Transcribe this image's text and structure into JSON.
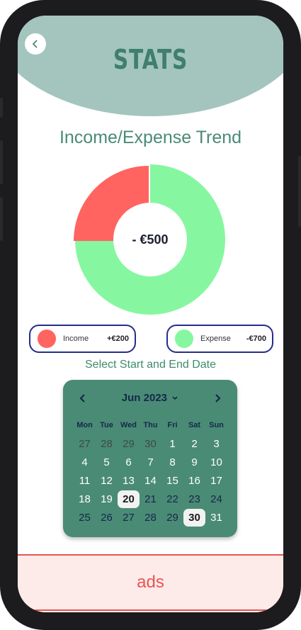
{
  "header": {
    "title": "STATS"
  },
  "section_title": "Income/Expense Trend",
  "donut": {
    "center_label": "- €500",
    "income_fraction": 0.25,
    "expense_fraction": 0.75,
    "income_color": "#ff6461",
    "expense_color": "#86f7a0"
  },
  "legend": {
    "income": {
      "label": "Income",
      "value": "+€200",
      "color": "#ff6461"
    },
    "expense": {
      "label": "Expense",
      "value": "-€700",
      "color": "#86f7a0"
    }
  },
  "date_hint": "Select Start and End Date",
  "calendar": {
    "month_label": "Jun 2023",
    "weekdays": [
      "Mon",
      "Tue",
      "Wed",
      "Thu",
      "Fri",
      "Sat",
      "Sun"
    ],
    "weeks": [
      [
        {
          "d": "27",
          "s": "muted"
        },
        {
          "d": "28",
          "s": "muted"
        },
        {
          "d": "29",
          "s": "muted"
        },
        {
          "d": "30",
          "s": "muted"
        },
        {
          "d": "1",
          "s": ""
        },
        {
          "d": "2",
          "s": ""
        },
        {
          "d": "3",
          "s": ""
        }
      ],
      [
        {
          "d": "4",
          "s": ""
        },
        {
          "d": "5",
          "s": ""
        },
        {
          "d": "6",
          "s": ""
        },
        {
          "d": "7",
          "s": ""
        },
        {
          "d": "8",
          "s": ""
        },
        {
          "d": "9",
          "s": ""
        },
        {
          "d": "10",
          "s": ""
        }
      ],
      [
        {
          "d": "11",
          "s": ""
        },
        {
          "d": "12",
          "s": ""
        },
        {
          "d": "13",
          "s": ""
        },
        {
          "d": "14",
          "s": ""
        },
        {
          "d": "15",
          "s": ""
        },
        {
          "d": "16",
          "s": ""
        },
        {
          "d": "17",
          "s": ""
        }
      ],
      [
        {
          "d": "18",
          "s": ""
        },
        {
          "d": "19",
          "s": ""
        },
        {
          "d": "20",
          "s": "sel"
        },
        {
          "d": "21",
          "s": "dark"
        },
        {
          "d": "22",
          "s": "dark"
        },
        {
          "d": "23",
          "s": "dark"
        },
        {
          "d": "24",
          "s": "dark"
        }
      ],
      [
        {
          "d": "25",
          "s": "dark"
        },
        {
          "d": "26",
          "s": "dark"
        },
        {
          "d": "27",
          "s": "dark"
        },
        {
          "d": "28",
          "s": "dark"
        },
        {
          "d": "29",
          "s": "dark"
        },
        {
          "d": "30",
          "s": "sel"
        },
        {
          "d": "31",
          "s": ""
        }
      ]
    ]
  },
  "ads": {
    "label": "ads"
  },
  "icons": {
    "back": "chevron-left-icon",
    "prev": "chevron-left-icon",
    "next": "chevron-right-icon",
    "dropdown": "chevron-down-icon"
  }
}
